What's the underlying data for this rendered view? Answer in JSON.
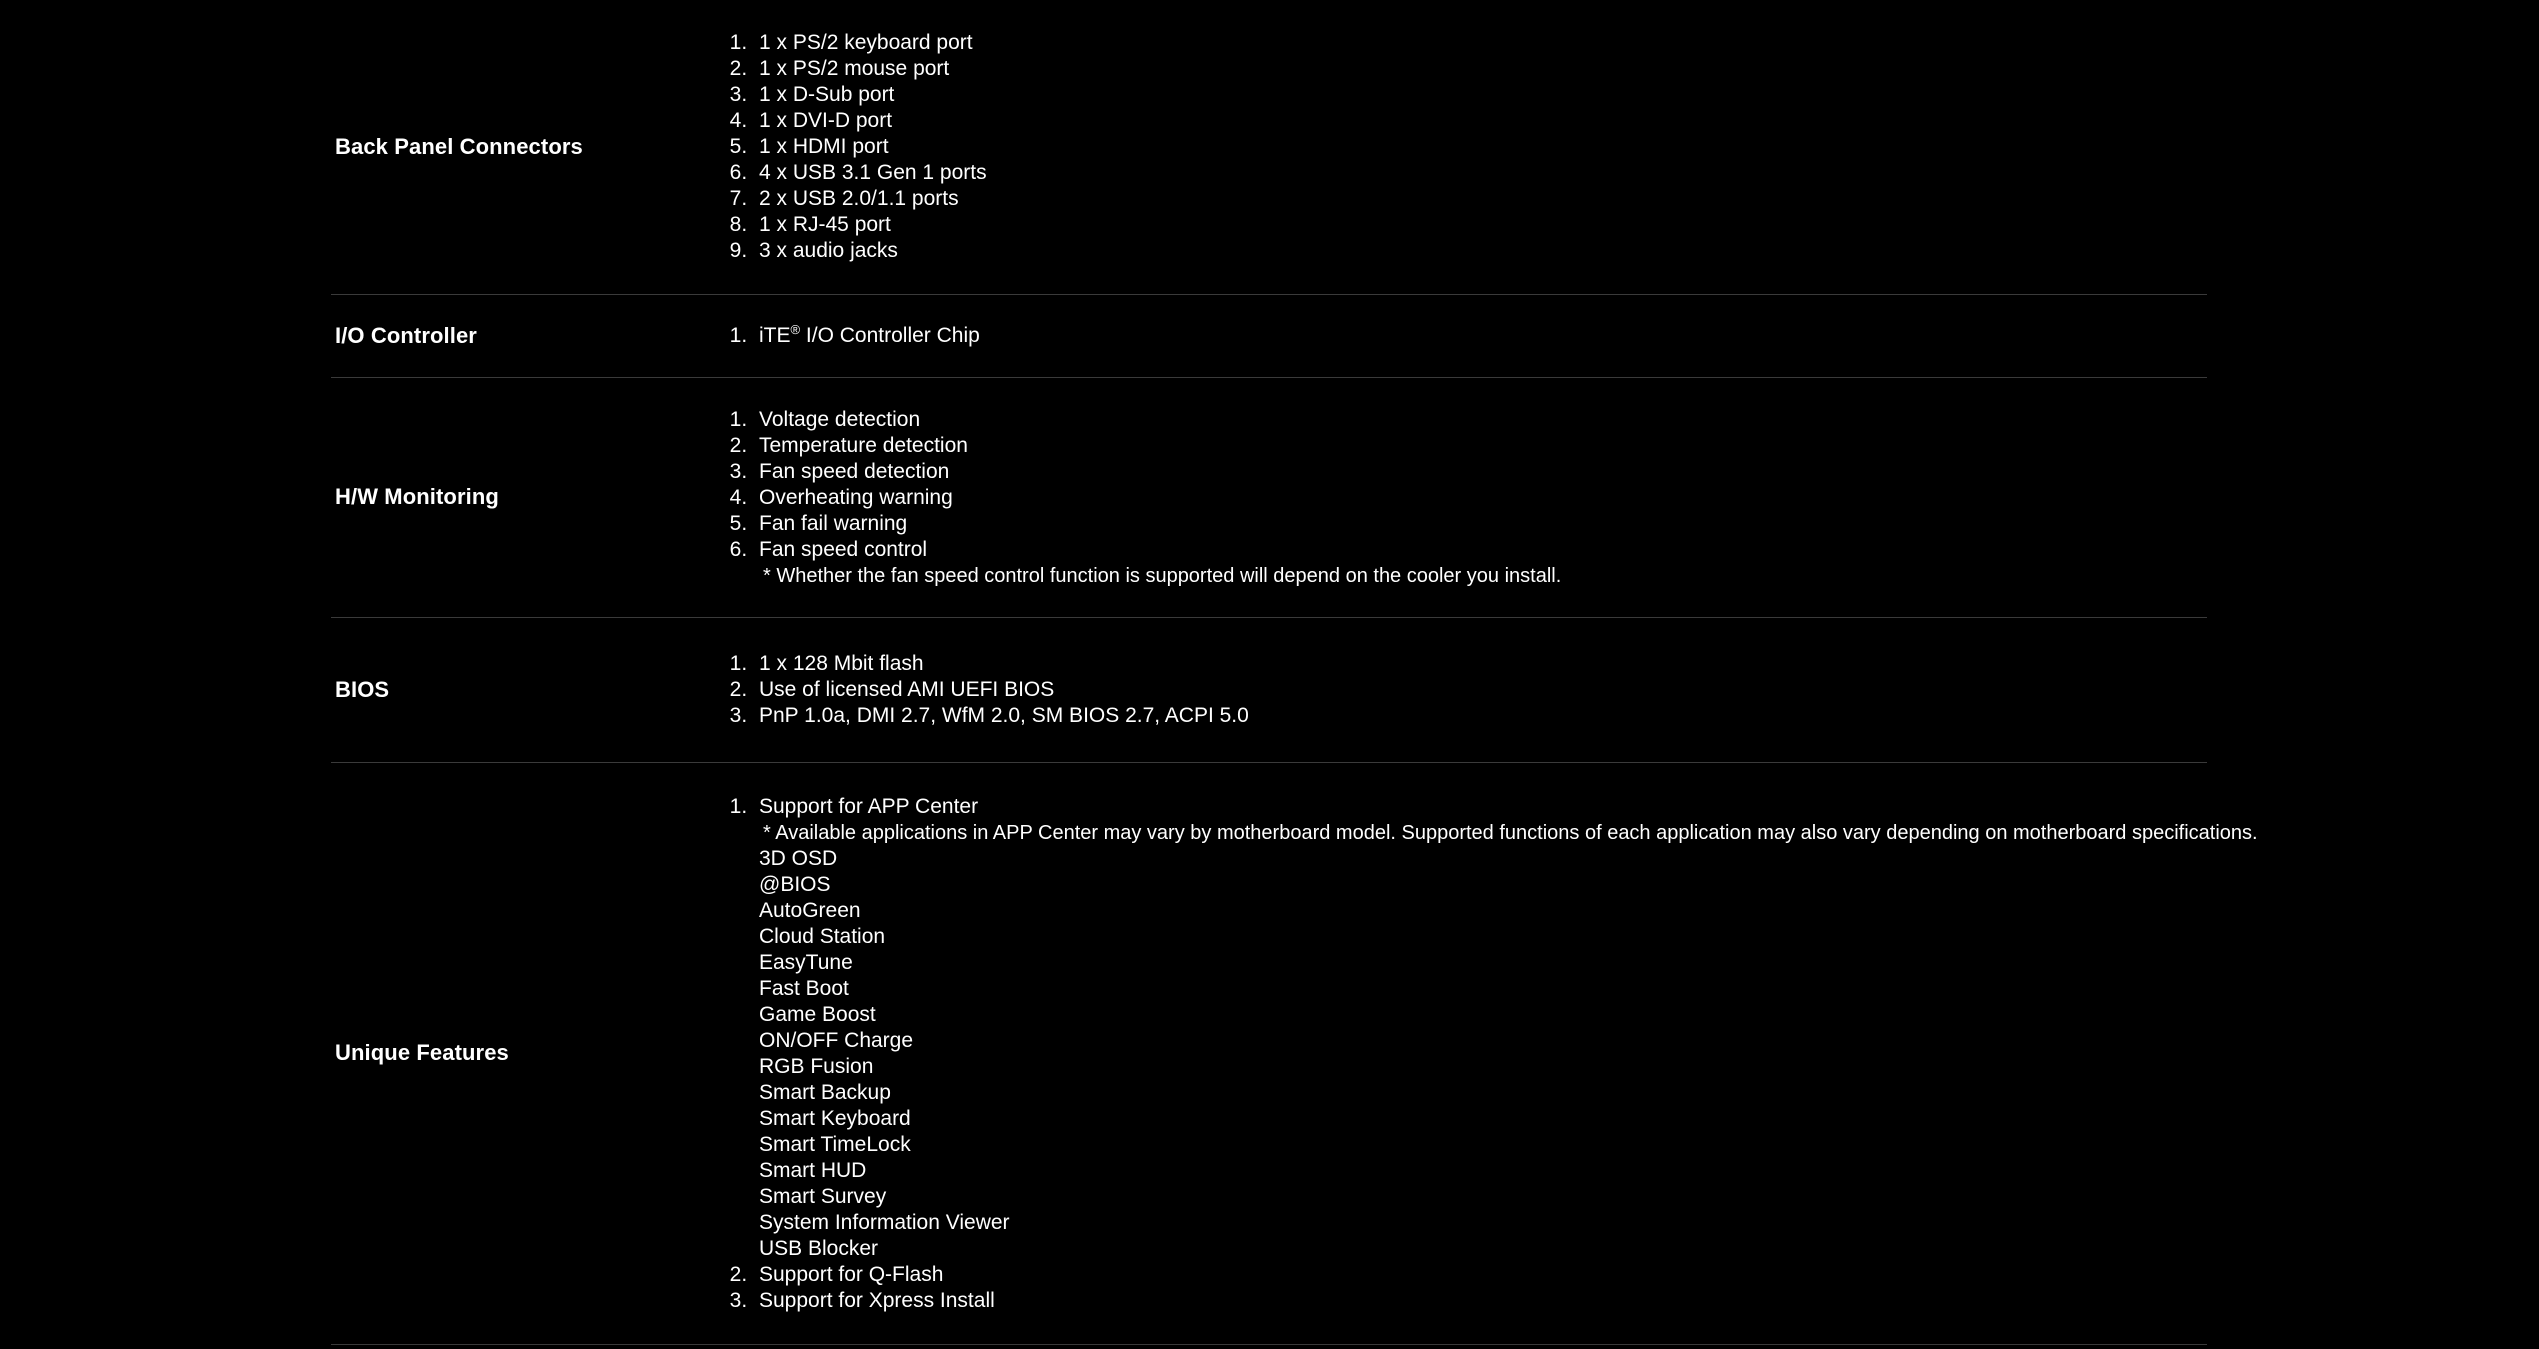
{
  "page": {
    "background_color": "#000000",
    "text_color": "#ffffff",
    "divider_color": "#3a3a3a"
  },
  "spec_rows": [
    {
      "label": "Back Panel Connectors",
      "items": [
        "1 x PS/2 keyboard port",
        "1 x PS/2 mouse port",
        "1 x D-Sub port",
        "1 x DVI-D port",
        "1 x HDMI port",
        "4 x USB 3.1 Gen 1 ports",
        "2 x USB 2.0/1.1 ports",
        "1 x RJ-45 port",
        "3 x audio jacks"
      ]
    },
    {
      "label": "I/O Controller",
      "items": [
        "iTE® I/O Controller Chip"
      ],
      "item_prefix": "iTE",
      "item_superscript": "®",
      "item_suffix": " I/O Controller Chip"
    },
    {
      "label": "H/W Monitoring",
      "items": [
        "Voltage detection",
        "Temperature detection",
        "Fan speed detection",
        "Overheating warning",
        "Fan fail warning",
        "Fan speed control"
      ],
      "note": "* Whether the fan speed control function is supported will depend on the cooler you install."
    },
    {
      "label": "BIOS",
      "items": [
        "1 x 128 Mbit flash",
        "Use of licensed AMI UEFI BIOS",
        "PnP 1.0a, DMI 2.7, WfM 2.0, SM BIOS 2.7, ACPI 5.0"
      ]
    },
    {
      "label": "Unique Features",
      "items": [
        "Support for APP Center",
        "Support for Q-Flash",
        "Support for Xpress Install"
      ],
      "app_center_note": "* Available applications in APP Center may vary by motherboard model. Supported functions of each application may also vary depending on motherboard specifications.",
      "app_center_apps": [
        "3D OSD",
        "@BIOS",
        "AutoGreen",
        "Cloud Station",
        "EasyTune",
        "Fast Boot",
        "Game Boost",
        "ON/OFF Charge",
        "RGB Fusion",
        "Smart Backup",
        "Smart Keyboard",
        "Smart TimeLock",
        "Smart HUD",
        "Smart Survey",
        "System Information Viewer",
        "USB Blocker"
      ]
    }
  ]
}
